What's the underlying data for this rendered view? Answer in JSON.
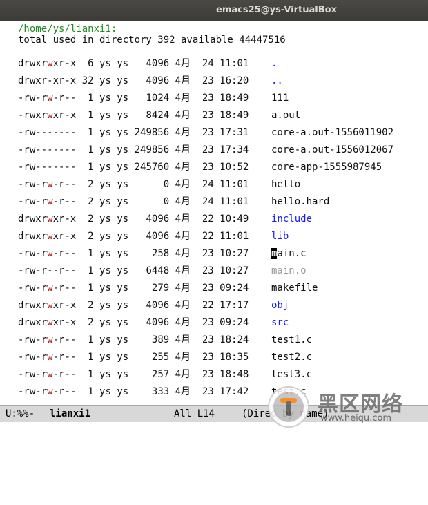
{
  "window": {
    "title": "emacs25@ys-VirtualBox"
  },
  "dired": {
    "header": "/home/ys/lianxi1:",
    "total_line": "total used in directory 392 available 44447516",
    "entries": [
      {
        "perm_a": "drwxr",
        "perm_w": "w",
        "perm_b": "xr-x",
        "info": "  6 ys ys   4096 4月  24 11:01 ",
        "name": ".",
        "kind": "dir"
      },
      {
        "perm_a": "drwxr-xr-x",
        "perm_w": "",
        "perm_b": "",
        "info": " 32 ys ys   4096 4月  23 16:20 ",
        "name": "..",
        "kind": "dir"
      },
      {
        "perm_a": "-rw-r",
        "perm_w": "w",
        "perm_b": "-r--",
        "info": "  1 ys ys   1024 4月  23 18:49 ",
        "name": "111",
        "kind": "file"
      },
      {
        "perm_a": "-rwxr",
        "perm_w": "w",
        "perm_b": "xr-x",
        "info": "  1 ys ys   8424 4月  23 18:49 ",
        "name": "a.out",
        "kind": "file"
      },
      {
        "perm_a": "-rw-------",
        "perm_w": "",
        "perm_b": "",
        "info": "  1 ys ys 249856 4月  23 17:31 ",
        "name": "core-a.out-1556011902",
        "kind": "file"
      },
      {
        "perm_a": "-rw-------",
        "perm_w": "",
        "perm_b": "",
        "info": "  1 ys ys 249856 4月  23 17:34 ",
        "name": "core-a.out-1556012067",
        "kind": "file"
      },
      {
        "perm_a": "-rw-------",
        "perm_w": "",
        "perm_b": "",
        "info": "  1 ys ys 245760 4月  23 10:52 ",
        "name": "core-app-1555987945",
        "kind": "file"
      },
      {
        "perm_a": "-rw-r",
        "perm_w": "w",
        "perm_b": "-r--",
        "info": "  2 ys ys      0 4月  24 11:01 ",
        "name": "hello",
        "kind": "file"
      },
      {
        "perm_a": "-rw-r",
        "perm_w": "w",
        "perm_b": "-r--",
        "info": "  2 ys ys      0 4月  24 11:01 ",
        "name": "hello.hard",
        "kind": "file"
      },
      {
        "perm_a": "drwxr",
        "perm_w": "w",
        "perm_b": "xr-x",
        "info": "  2 ys ys   4096 4月  22 10:49 ",
        "name": "include",
        "kind": "dir"
      },
      {
        "perm_a": "drwxr",
        "perm_w": "w",
        "perm_b": "xr-x",
        "info": "  2 ys ys   4096 4月  22 11:01 ",
        "name": "lib",
        "kind": "dir"
      },
      {
        "perm_a": "-rw-r",
        "perm_w": "w",
        "perm_b": "-r--",
        "info": "  1 ys ys    258 4月  23 10:27 ",
        "name": "main.c",
        "kind": "cursor"
      },
      {
        "perm_a": "-rw-r--r--",
        "perm_w": "",
        "perm_b": "",
        "info": "  1 ys ys   6448 4月  23 10:27 ",
        "name": "main.o",
        "kind": "dimmed"
      },
      {
        "perm_a": "-rw-r",
        "perm_w": "w",
        "perm_b": "-r--",
        "info": "  1 ys ys    279 4月  23 09:24 ",
        "name": "makefile",
        "kind": "file"
      },
      {
        "perm_a": "drwxr",
        "perm_w": "w",
        "perm_b": "xr-x",
        "info": "  2 ys ys   4096 4月  22 17:17 ",
        "name": "obj",
        "kind": "dir"
      },
      {
        "perm_a": "drwxr",
        "perm_w": "w",
        "perm_b": "xr-x",
        "info": "  2 ys ys   4096 4月  23 09:24 ",
        "name": "src",
        "kind": "dir"
      },
      {
        "perm_a": "-rw-r",
        "perm_w": "w",
        "perm_b": "-r--",
        "info": "  1 ys ys    389 4月  23 18:24 ",
        "name": "test1.c",
        "kind": "file"
      },
      {
        "perm_a": "-rw-r",
        "perm_w": "w",
        "perm_b": "-r--",
        "info": "  1 ys ys    255 4月  23 18:35 ",
        "name": "test2.c",
        "kind": "file"
      },
      {
        "perm_a": "-rw-r",
        "perm_w": "w",
        "perm_b": "-r--",
        "info": "  1 ys ys    257 4月  23 18:48 ",
        "name": "test3.c",
        "kind": "file"
      },
      {
        "perm_a": "-rw-r",
        "perm_w": "w",
        "perm_b": "-r--",
        "info": "  1 ys ys    333 4月  23 17:42 ",
        "name": "test.c",
        "kind": "file"
      }
    ]
  },
  "modeline": {
    "status": "U:%%-",
    "buffer": "lianxi1",
    "position": "All L14",
    "mode": "(Dired by name)"
  },
  "watermark": {
    "text": "黑区网络",
    "url": "www.heiqu.com"
  },
  "colors": {
    "dir": "#1a1aff",
    "write_bit": "#b22222",
    "header": "#228b22",
    "dimmed": "#9a9a9a"
  }
}
